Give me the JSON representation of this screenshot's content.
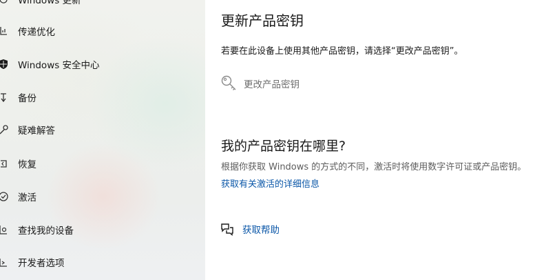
{
  "sidebar": {
    "items": [
      {
        "label": "Windows 更新",
        "icon": "refresh-icon"
      },
      {
        "label": "传递优化",
        "icon": "delivery-optimization-icon"
      },
      {
        "label": "Windows 安全中心",
        "icon": "shield-icon"
      },
      {
        "label": "备份",
        "icon": "backup-arrow-icon"
      },
      {
        "label": "疑难解答",
        "icon": "wrench-icon"
      },
      {
        "label": "恢复",
        "icon": "recovery-icon"
      },
      {
        "label": "激活",
        "icon": "activation-check-icon"
      },
      {
        "label": "查找我的设备",
        "icon": "find-device-icon"
      },
      {
        "label": "开发者选项",
        "icon": "developer-icon"
      }
    ]
  },
  "main": {
    "update_key": {
      "title": "更新产品密钥",
      "description": "若要在此设备上使用其他产品密钥，请选择“更改产品密钥”。",
      "change_key_label": "更改产品密钥",
      "change_key_icon": "key-icon"
    },
    "where_key": {
      "title": "我的产品密钥在哪里?",
      "description": "根据你获取 Windows 的方式的不同，激活时将使用数字许可证或产品密钥。",
      "link": "获取有关激活的详细信息"
    },
    "help": {
      "label": "获取帮助",
      "icon": "help-chat-icon"
    }
  },
  "colors": {
    "link": "#0b57a8",
    "text": "#1a1a1a",
    "muted": "#6d6d6d"
  }
}
